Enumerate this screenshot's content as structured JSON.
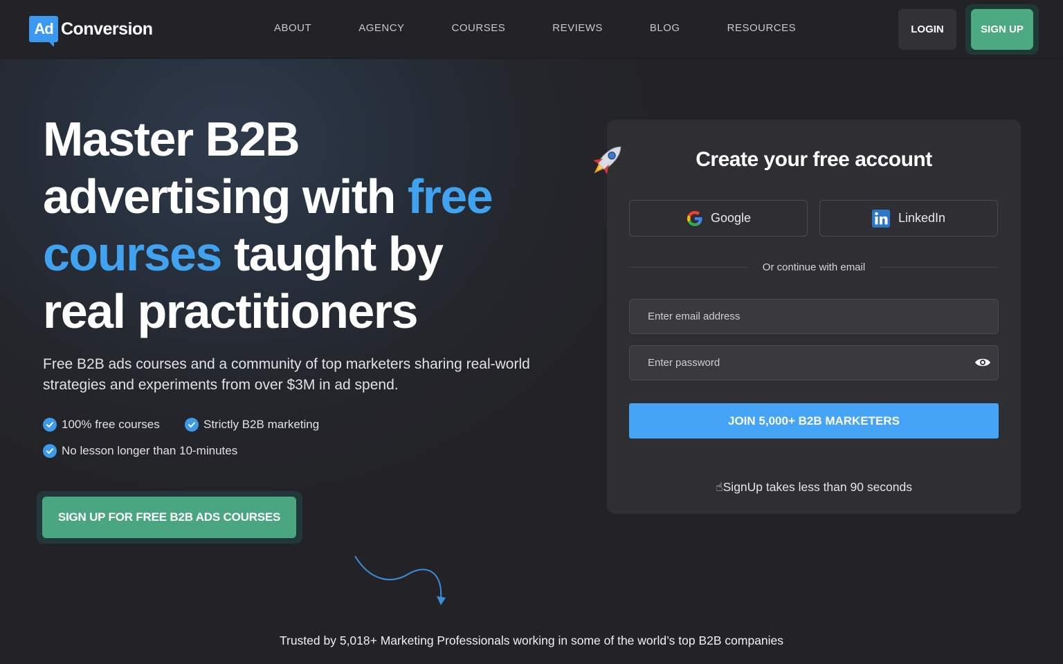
{
  "nav": {
    "logo_badge": "Ad",
    "logo_text": "Conversion",
    "links": [
      "ABOUT",
      "AGENCY",
      "COURSES",
      "REVIEWS",
      "BLOG",
      "RESOURCES"
    ],
    "login_label": "LOGIN",
    "signup_label": "SIGN UP"
  },
  "hero": {
    "headline_1": "Master B2B",
    "headline_2": "advertising with",
    "headline_accent_1": "free",
    "headline_accent_2": "courses",
    "headline_3": "taught by",
    "headline_4": "real practitioners",
    "subtext": "Free B2B ads courses and a community of top marketers sharing real-world strategies and experiments from over $3M in ad spend.",
    "features": [
      "100% free courses",
      "Strictly B2B marketing",
      "No lesson longer than 10-minutes"
    ],
    "cta_label": "SIGN UP FOR FREE B2B ADS COURSES",
    "trusted": "Trusted by 5,018+  Marketing Professionals working in some of the world’s top B2B companies"
  },
  "signup_card": {
    "title": "Create your free account",
    "google_label": "Google",
    "linkedin_label": "LinkedIn",
    "divider_text": "Or continue with email",
    "email_placeholder": "Enter email address",
    "password_placeholder": "Enter password",
    "join_label": "JOIN 5,000+ B2B MARKETERS",
    "note": "☝SignUp takes less than 90 seconds"
  },
  "colors": {
    "accent_blue": "#41a3ef",
    "cta_green": "#4aa680",
    "background": "#232327",
    "card": "#2f2f33"
  },
  "icons": [
    "rocket-icon",
    "google-icon",
    "linkedin-icon",
    "check-icon",
    "eye-icon",
    "curved-arrow-icon"
  ]
}
